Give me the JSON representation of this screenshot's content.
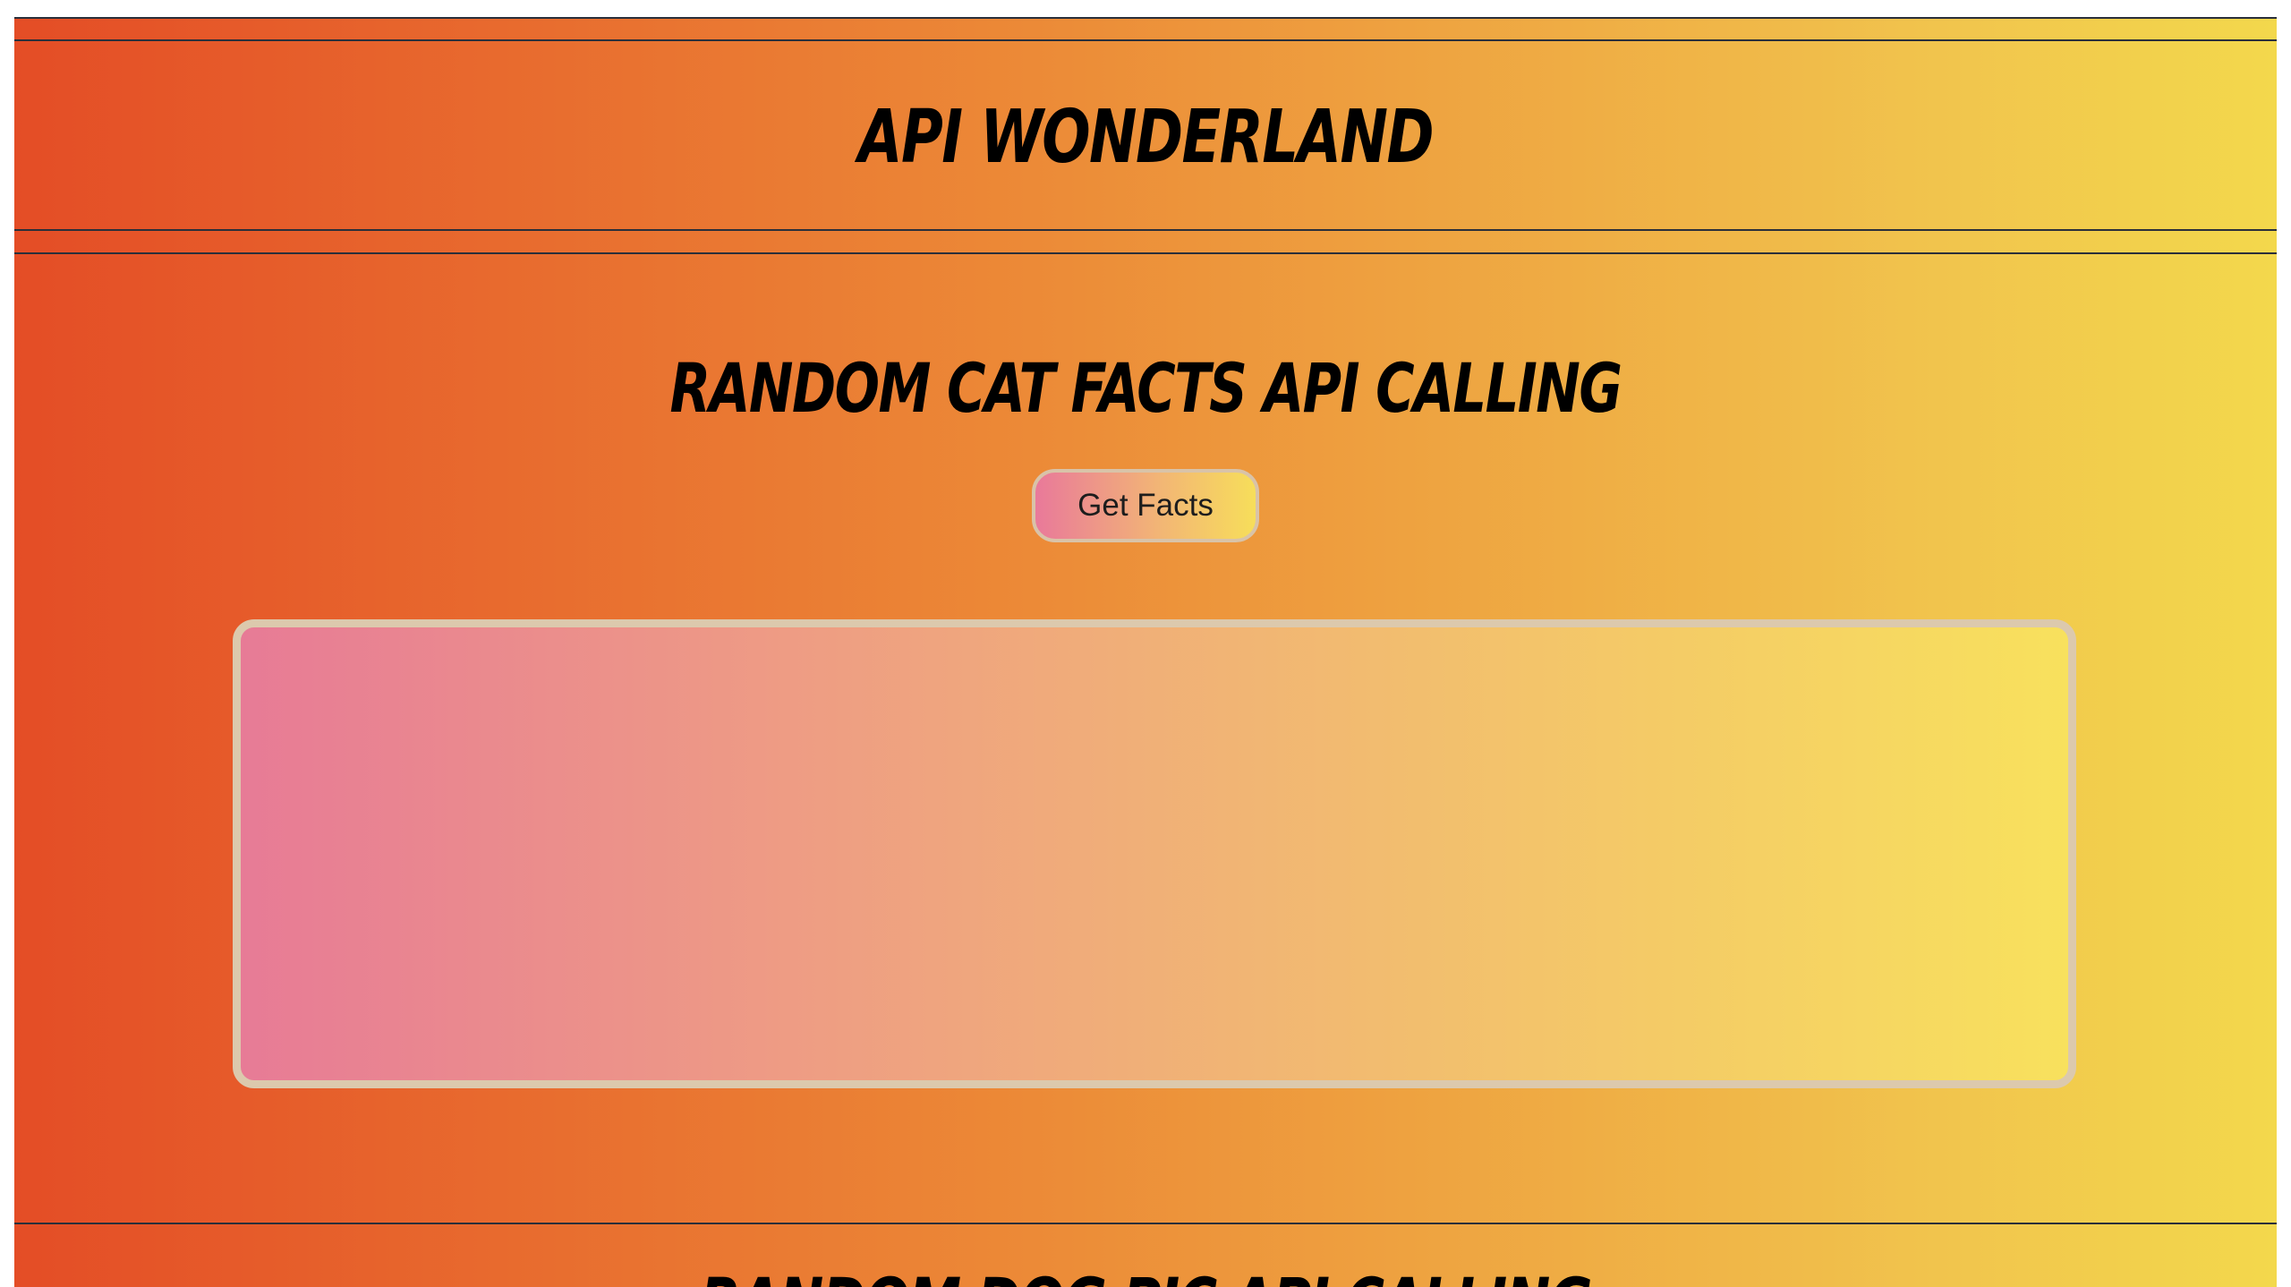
{
  "header": {
    "title": "API WONDERLAND"
  },
  "cat_section": {
    "title": "RANDOM CAT FACTS API CALLING",
    "button_label": "Get Facts",
    "facts_text": ""
  },
  "next_section": {
    "title": "RANDOM DOG PIC API CALLING"
  },
  "colors": {
    "gradient_start": "#e44d26",
    "gradient_end": "#f3d84c",
    "rule": "#2a2f3a"
  }
}
